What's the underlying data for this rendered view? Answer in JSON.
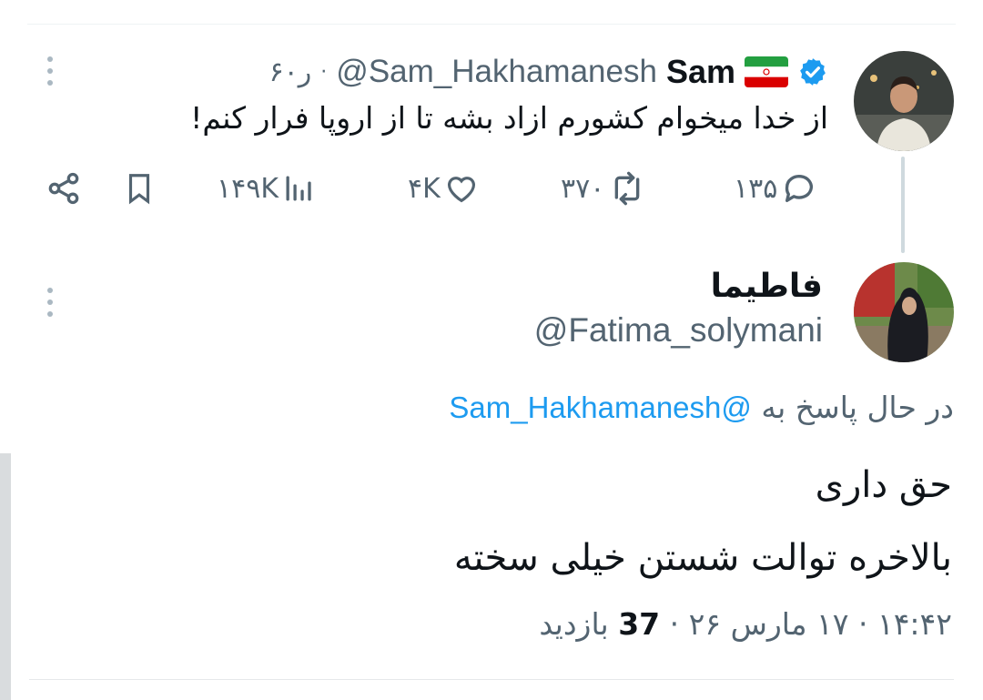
{
  "original_tweet": {
    "author_name": "Sam",
    "handle": "@Sam_Hakhamanesh",
    "time": "۶۰ر",
    "text": "از خدا میخوام کشورم ازاد بشه تا از اروپا فرار کنم!",
    "stats": {
      "replies": "۱۳۵",
      "retweets": "۳۷۰",
      "likes": "۴K",
      "views": "۱۴۹K"
    },
    "icons": [
      "verified-badge-icon",
      "iran-flag-icon",
      "reply-icon",
      "retweet-icon",
      "like-icon",
      "views-icon",
      "bookmark-icon",
      "share-icon",
      "more-icon"
    ]
  },
  "reply_tweet": {
    "author_name": "فاطیما",
    "handle": "@Fatima_solymani",
    "replying_to_label": "در حال پاسخ به",
    "replying_to_handle": "@Sam_Hakhamanesh",
    "text_line1": "حق داری",
    "text_line2": "بالاخره توالت شستن خیلی سخته",
    "time": "۱۴:۴۲",
    "date": "۱۷ مارس ۲۶",
    "views_count": "37",
    "views_label": "بازدید"
  },
  "colors": {
    "accent": "#1d9bf0",
    "text_primary": "#0f1419",
    "text_secondary": "#536471",
    "thread_line": "#cfd9de"
  }
}
